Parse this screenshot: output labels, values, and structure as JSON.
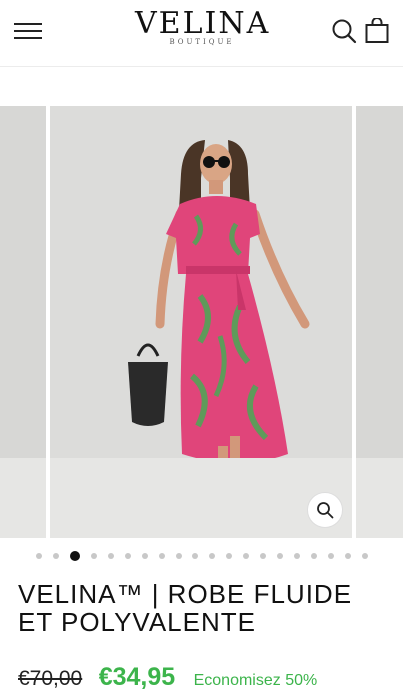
{
  "header": {
    "logo_main": "VELINA",
    "logo_sub": "BOUTIQUE"
  },
  "icons": {
    "menu": "hamburger-icon",
    "search": "search-icon",
    "cart": "shopping-bag-icon",
    "zoom": "zoom-icon"
  },
  "gallery": {
    "slide_count": 20,
    "active_index": 2
  },
  "product": {
    "title": "VELINA™ | ROBE FLUIDE ET POLYVALENTE",
    "old_price": "€70,00",
    "new_price": "€34,95",
    "savings": "Economisez 50%"
  },
  "colors": {
    "sale_green": "#3cb44b",
    "dress_pink": "#e0457a",
    "dress_green": "#5f9a5a"
  }
}
